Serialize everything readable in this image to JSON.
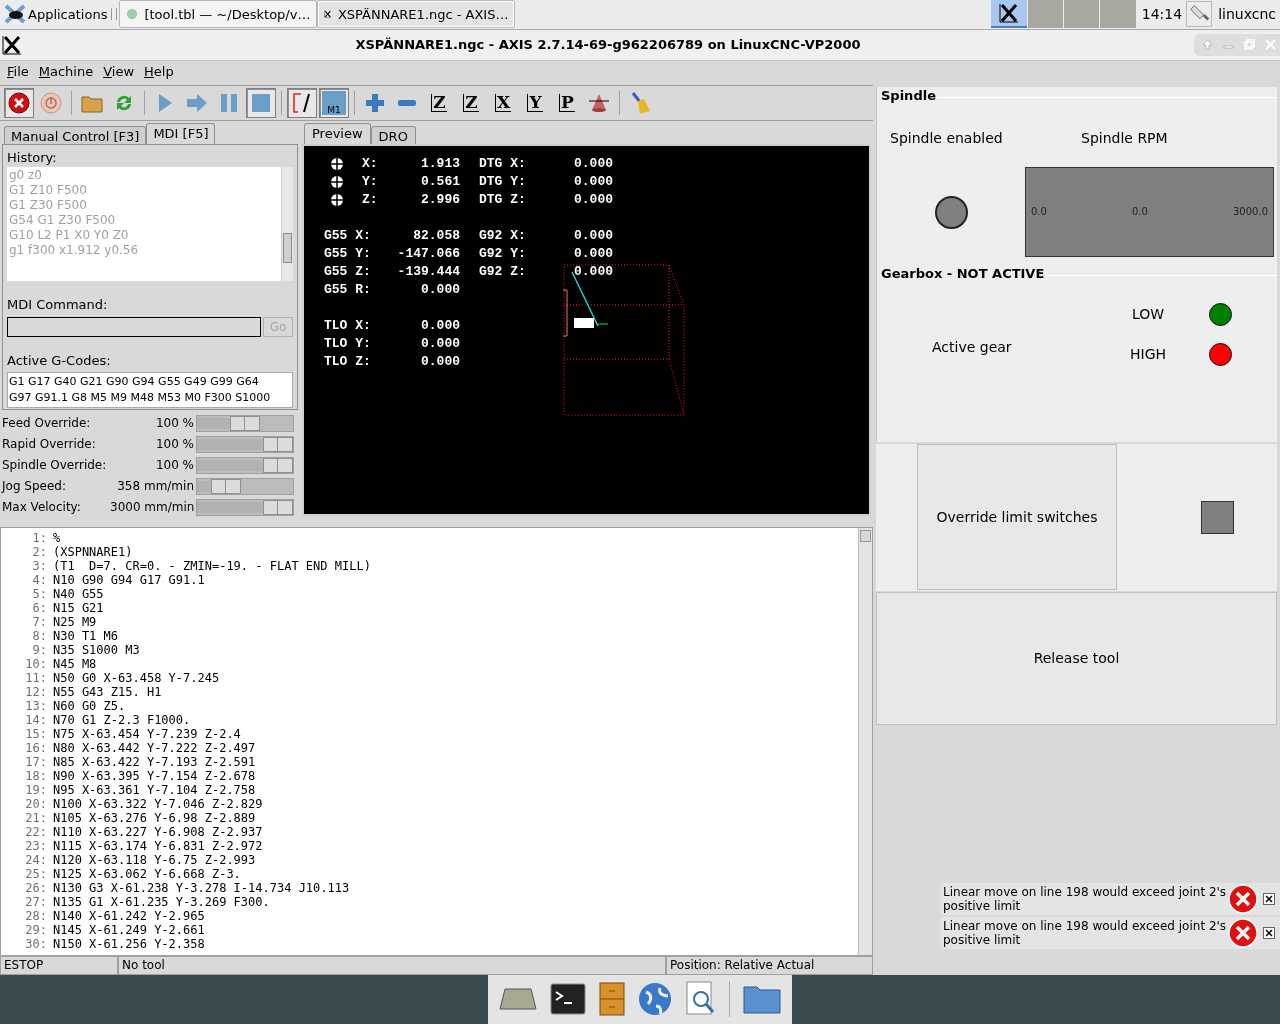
{
  "taskbar": {
    "apps_label": "Applications",
    "tasks": [
      {
        "label": "[tool.tbl — ~/Desktop/v…",
        "selected": false
      },
      {
        "label": "XSPÄNNARE1.ngc - AXIS…",
        "selected": true
      }
    ],
    "clock": "14:14",
    "user": "linuxcnc"
  },
  "window": {
    "title": "XSPÄNNARE1.ngc - AXIS 2.7.14-69-g962206789 on LinuxCNC-VP2000"
  },
  "menu": [
    "File",
    "Machine",
    "View",
    "Help"
  ],
  "toolbar": [
    {
      "kind": "estop",
      "pressed": true
    },
    {
      "kind": "power",
      "pressed": false
    },
    {
      "kind": "open",
      "pressed": false
    },
    {
      "kind": "reload",
      "pressed": false
    },
    {
      "kind": "run",
      "pressed": false
    },
    {
      "kind": "step",
      "pressed": false
    },
    {
      "kind": "pause",
      "pressed": false
    },
    {
      "kind": "stop",
      "pressed": true
    },
    {
      "kind": "blockdelete",
      "pressed": true
    },
    {
      "kind": "optstop",
      "pressed": true,
      "text": "M1"
    },
    {
      "kind": "zoomin",
      "pressed": false
    },
    {
      "kind": "zoomout",
      "pressed": false
    },
    {
      "kind": "view",
      "pressed": false,
      "text": "Z"
    },
    {
      "kind": "view",
      "pressed": false,
      "text": "Z"
    },
    {
      "kind": "view",
      "pressed": false,
      "text": "X"
    },
    {
      "kind": "view",
      "pressed": false,
      "text": "Y"
    },
    {
      "kind": "view",
      "pressed": false,
      "text": "P"
    },
    {
      "kind": "rotate",
      "pressed": false
    },
    {
      "kind": "clear",
      "pressed": false
    }
  ],
  "left_tabs": [
    {
      "label": "Manual Control [F3]",
      "selected": false
    },
    {
      "label": "MDI [F5]",
      "selected": true
    }
  ],
  "mdi": {
    "history_label": "History:",
    "history": [
      "g0 z0",
      "G1 Z10 F500",
      "G1 Z30 F500",
      "G54 G1 Z30 F500",
      "G10 L2 P1 X0 Y0 Z0",
      "g1 f300 x1.912 y0.56"
    ],
    "command_label": "MDI Command:",
    "go": {
      "label": "Go",
      "disabled": true
    },
    "active_label": "Active G-Codes:",
    "active_codes": [
      "G1 G17 G40 G21 G90 G94 G55 G49 G99 G64",
      "G97 G91.1 G8 M5 M9 M48 M53 M0 F300 S1000"
    ]
  },
  "sliders": [
    {
      "label": "Feed Override:",
      "value": "100 %",
      "level": 0.5
    },
    {
      "label": "Rapid Override:",
      "value": "100 %",
      "level": 1
    },
    {
      "label": "Spindle Override:",
      "value": "100 %",
      "level": 1
    },
    {
      "label": "Jog Speed:",
      "value": "358 mm/min",
      "level": 0.3
    },
    {
      "label": "Max Velocity:",
      "value": "3000 mm/min",
      "level": 1
    }
  ],
  "preview_tabs": [
    {
      "label": "Preview",
      "selected": true
    },
    {
      "label": "DRO",
      "selected": false
    }
  ],
  "dro": [
    [
      {
        "homed": true,
        "label": "X:",
        "value": "1.913",
        "label2": "DTG X:",
        "value2": "0.000"
      },
      {
        "homed": true,
        "label": "Y:",
        "value": "0.561",
        "label2": "DTG Y:",
        "value2": "0.000"
      },
      {
        "homed": true,
        "label": "Z:",
        "value": "2.996",
        "label2": "DTG Z:",
        "value2": "0.000"
      }
    ],
    [
      {
        "homed": false,
        "label": "G55 X:",
        "value": "82.058",
        "label2": "G92 X:",
        "value2": "0.000"
      },
      {
        "homed": false,
        "label": "G55 Y:",
        "value": "-147.066",
        "label2": "G92 Y:",
        "value2": "0.000"
      },
      {
        "homed": false,
        "label": "G55 Z:",
        "value": "-139.444",
        "label2": "G92 Z:",
        "value2": "0.000"
      },
      {
        "homed": false,
        "label": "G55 R:",
        "value": "0.000"
      }
    ],
    [
      {
        "homed": false,
        "label": "TLO X:",
        "value": "0.000"
      },
      {
        "homed": false,
        "label": "TLO Y:",
        "value": "0.000"
      },
      {
        "homed": false,
        "label": "TLO Z:",
        "value": "0.000"
      }
    ]
  ],
  "program": [
    {
      "n": "1:",
      "code": "%"
    },
    {
      "n": "2:",
      "code": "(XSPNNARE1)"
    },
    {
      "n": "3:",
      "code": "(T1  D=7. CR=0. - ZMIN=-19. - FLAT END MILL)"
    },
    {
      "n": "4:",
      "code": "N10 G90 G94 G17 G91.1"
    },
    {
      "n": "5:",
      "code": "N40 G55"
    },
    {
      "n": "6:",
      "code": "N15 G21"
    },
    {
      "n": "7:",
      "code": "N25 M9"
    },
    {
      "n": "8:",
      "code": "N30 T1 M6"
    },
    {
      "n": "9:",
      "code": "N35 S1000 M3"
    },
    {
      "n": "10:",
      "code": "N45 M8"
    },
    {
      "n": "11:",
      "code": "N50 G0 X-63.458 Y-7.245"
    },
    {
      "n": "12:",
      "code": "N55 G43 Z15. H1"
    },
    {
      "n": "13:",
      "code": "N60 G0 Z5."
    },
    {
      "n": "14:",
      "code": "N70 G1 Z-2.3 F1000."
    },
    {
      "n": "15:",
      "code": "N75 X-63.454 Y-7.239 Z-2.4"
    },
    {
      "n": "16:",
      "code": "N80 X-63.442 Y-7.222 Z-2.497"
    },
    {
      "n": "17:",
      "code": "N85 X-63.422 Y-7.193 Z-2.591"
    },
    {
      "n": "18:",
      "code": "N90 X-63.395 Y-7.154 Z-2.678"
    },
    {
      "n": "19:",
      "code": "N95 X-63.361 Y-7.104 Z-2.758"
    },
    {
      "n": "20:",
      "code": "N100 X-63.322 Y-7.046 Z-2.829"
    },
    {
      "n": "21:",
      "code": "N105 X-63.276 Y-6.98 Z-2.889"
    },
    {
      "n": "22:",
      "code": "N110 X-63.227 Y-6.908 Z-2.937"
    },
    {
      "n": "23:",
      "code": "N115 X-63.174 Y-6.831 Z-2.972"
    },
    {
      "n": "24:",
      "code": "N120 X-63.118 Y-6.75 Z-2.993"
    },
    {
      "n": "25:",
      "code": "N125 X-63.062 Y-6.668 Z-3."
    },
    {
      "n": "26:",
      "code": "N130 G3 X-61.238 Y-3.278 I-14.734 J10.113"
    },
    {
      "n": "27:",
      "code": "N135 G1 X-61.235 Y-3.269 F300."
    },
    {
      "n": "28:",
      "code": "N140 X-61.242 Y-2.965"
    },
    {
      "n": "29:",
      "code": "N145 X-61.249 Y-2.661"
    },
    {
      "n": "30:",
      "code": "N150 X-61.256 Y-2.358"
    }
  ],
  "status_bar": [
    "ESTOP",
    "No tool",
    "Position: Relative Actual"
  ],
  "spindle": {
    "title": "Spindle",
    "enabled_label": "Spindle enabled",
    "rpm_label": "Spindle RPM",
    "enabled": false,
    "scale": [
      "0.0",
      "0.0",
      "3000.0"
    ]
  },
  "gearbox": {
    "title": "Gearbox - NOT ACTIVE",
    "active_label": "Active gear",
    "gears": [
      {
        "label": "LOW",
        "color": "#008000"
      },
      {
        "label": "HIGH",
        "color": "#ff0000"
      }
    ]
  },
  "override": {
    "label": "Override limit switches",
    "checked": false
  },
  "release": {
    "label": "Release tool"
  },
  "messages": [
    "Linear move on line 198 would exceed joint 2's positive limit",
    "Linear move on line 198 would exceed joint 2's positive limit"
  ]
}
